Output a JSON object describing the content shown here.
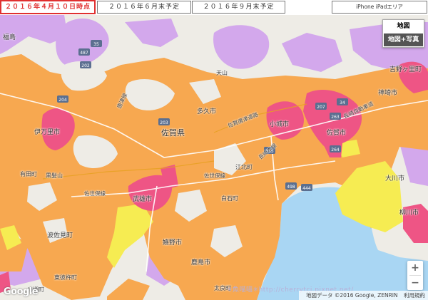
{
  "tabs": [
    {
      "label": "２０１６年４月１０日時点",
      "active": true
    },
    {
      "label": "２０１６年６月末予定",
      "active": false
    },
    {
      "label": "２０１６年９月末予定",
      "active": false
    }
  ],
  "iphone_tab": "iPhone iPadエリア",
  "map_type": {
    "map": "地図",
    "satellite": "地図+写真"
  },
  "zoom": {
    "in": "+",
    "out": "−"
  },
  "google_logo": "Google",
  "attribution": {
    "data": "地図データ ©2016 Google, ZENRIN",
    "terms": "利用規約"
  },
  "watermark": "✳魚喵喵✳http://cherrytcj.pixnet.net/",
  "labels": {
    "saga_pref": "佐賀県",
    "imari": "伊万里市",
    "arita": "有田町",
    "ureshino": "嬉野市",
    "takeo": "武雄市",
    "taku": "多久市",
    "ogi": "小城市",
    "saga_city": "佐賀市",
    "kanzaki": "神埼市",
    "yoshinogari": "吉野ヶ里町",
    "okawa": "大川市",
    "yanagawa": "柳川市",
    "shiroishi": "白石町",
    "kohoku": "江北町",
    "kashima": "鹿島市",
    "tara": "太良町",
    "hasami": "波佐見町",
    "higashisonogi": "東彼杵町",
    "kawatana": "川棚町",
    "fukushima": "福島",
    "tenzan": "天山",
    "kurokami": "黒髪山",
    "line_sasebo": "佐世保線",
    "line_nagasaki": "長崎本線",
    "line_karatsu": "唐津線",
    "exp_nagasaki": "長崎自動車道",
    "exp_nishikyushu": "西九州自動車道",
    "sagaairport_road": "佐賀唐津道路"
  },
  "route_numbers": [
    "487",
    "202",
    "204",
    "35",
    "203",
    "207",
    "264",
    "34",
    "444",
    "263",
    "385",
    "498"
  ],
  "colors": {
    "orange": "#f7a850",
    "purple": "#d3a8ec",
    "pink": "#ee5585",
    "yellow": "#f6ec52",
    "water": "#a9d6f3",
    "land": "#eeece6",
    "tab_active": "#e03030"
  }
}
